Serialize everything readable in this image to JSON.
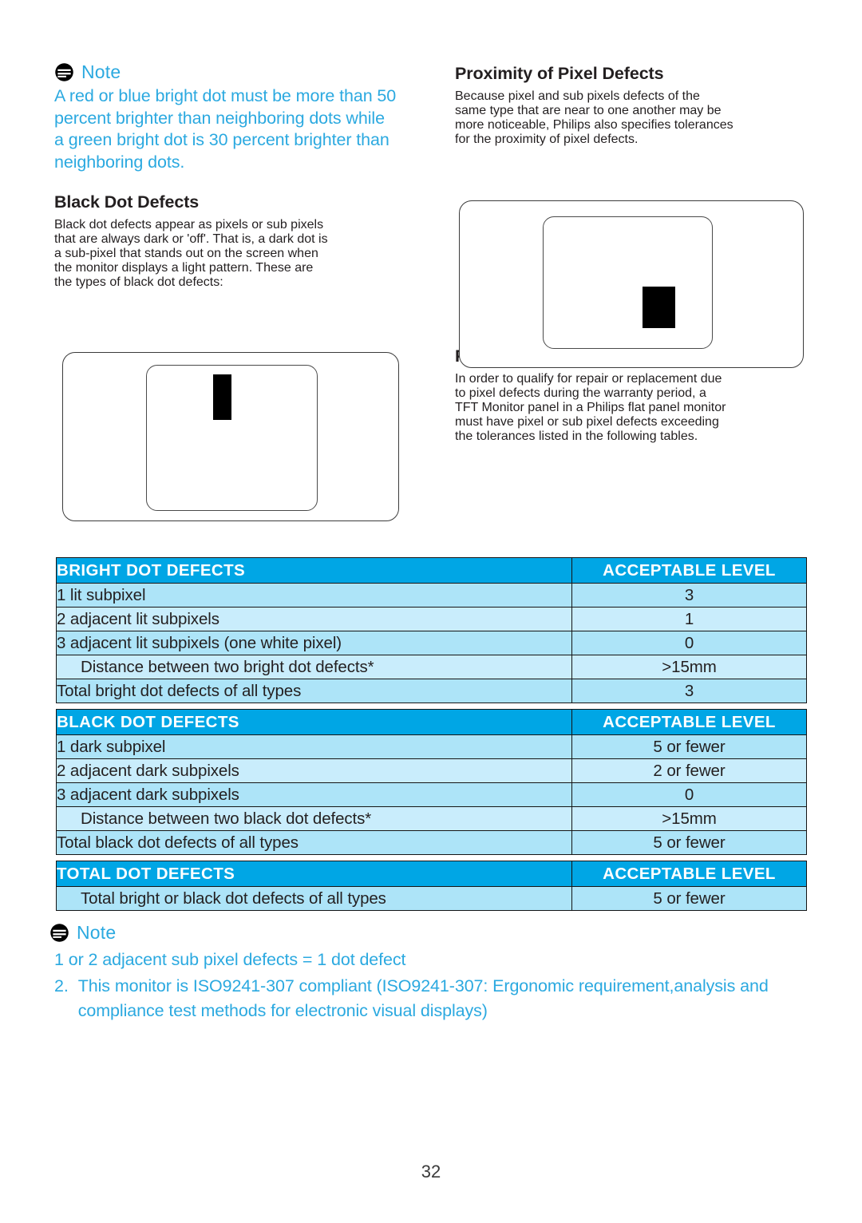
{
  "page": {
    "number": "32"
  },
  "notes": {
    "top": {
      "icon": "note-icon",
      "label": "Note",
      "lines": [
        "A red or blue bright dot must be more than 50",
        "percent brighter than neighboring dots while",
        "a green bright dot is 30 percent brighter than",
        "neighboring dots."
      ]
    },
    "bottom": {
      "icon": "note-icon",
      "label": "Note",
      "line1": "1 or 2 adjacent sub pixel defects = 1 dot defect",
      "item2_number": "2.",
      "item2_lines": [
        "This monitor is ISO9241-307 compliant (ISO9241-307: Ergonomic requirement,analysis and",
        "compliance test methods for electronic visual displays)"
      ]
    }
  },
  "left_column": {
    "black_dot_heading": "Black Dot Defects",
    "black_dot_lines": [
      "Black dot defects appear as pixels or sub pixels",
      "that are always dark or 'off'. That is, a dark dot is",
      "a sub-pixel that stands out on the screen when",
      "the monitor displays a light pattern. These are",
      "the types of black dot defects:"
    ]
  },
  "right_column": {
    "proximity_heading": "Proximity of Pixel Defects",
    "proximity_lines": [
      "Because pixel and sub pixels defects of the",
      "same type that are near to one another may be",
      "more noticeable, Philips also specifies tolerances",
      "for the proximity of pixel defects."
    ],
    "tolerances_heading": "Pixel Defect Tolerances",
    "tolerances_lines": [
      "In order to qualify for repair or replacement due",
      "to pixel defects during the warranty period, a",
      "TFT Monitor panel in a Philips flat panel monitor",
      "must have pixel or sub pixel defects exceeding",
      "the tolerances listed in the following tables."
    ]
  },
  "diagrams": {
    "left": {
      "name": "black-dot-defect-illustration"
    },
    "right": {
      "name": "pixel-defect-proximity-illustration"
    }
  },
  "colors": {
    "header_blue": "#00a6e5",
    "note_blue": "#2ba9e0",
    "row_blue": "#ade4f8",
    "row_blue_alt": "#c9edfc",
    "border": "#151515"
  },
  "tables": [
    {
      "id": "bright-dot-defects",
      "headers": [
        "BRIGHT DOT DEFECTS",
        "ACCEPTABLE LEVEL"
      ],
      "rows": [
        {
          "label": "1 lit subpixel",
          "value": "3",
          "indent": false
        },
        {
          "label": "2 adjacent lit subpixels",
          "value": "1",
          "indent": false
        },
        {
          "label": "3 adjacent lit subpixels (one white pixel)",
          "value": "0",
          "indent": false
        },
        {
          "label": "Distance between two bright dot defects*",
          "value": ">15mm",
          "indent": true
        },
        {
          "label": "Total bright dot defects of all types",
          "value": "3",
          "indent": false
        }
      ]
    },
    {
      "id": "black-dot-defects",
      "headers": [
        "BLACK DOT DEFECTS",
        "ACCEPTABLE LEVEL"
      ],
      "rows": [
        {
          "label": "1 dark subpixel",
          "value": "5 or fewer",
          "indent": false
        },
        {
          "label": "2 adjacent dark subpixels",
          "value": "2 or fewer",
          "indent": false
        },
        {
          "label": "3 adjacent dark subpixels",
          "value": "0",
          "indent": false
        },
        {
          "label": "Distance between two black dot defects*",
          "value": ">15mm",
          "indent": true
        },
        {
          "label": "Total black dot defects of all types",
          "value": "5 or fewer",
          "indent": false
        }
      ]
    },
    {
      "id": "total-dot-defects",
      "headers": [
        "TOTAL DOT DEFECTS",
        "ACCEPTABLE LEVEL"
      ],
      "rows": [
        {
          "label": "Total bright or black dot defects of all types",
          "value": "5 or fewer",
          "indent": true
        }
      ]
    }
  ]
}
